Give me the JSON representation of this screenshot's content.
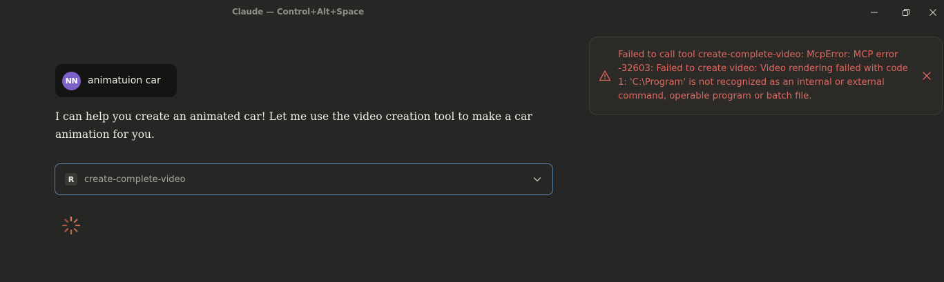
{
  "window": {
    "title": "Claude — Control+Alt+Space"
  },
  "user_message": {
    "avatar_initials": "NN",
    "text": "animatuion car"
  },
  "assistant_message": {
    "text": "I can help you create an animated car! Let me use the video creation tool to make a car animation for you."
  },
  "tool_call": {
    "icon_letter": "R",
    "name": "create-complete-video",
    "chevron_icon": "chevron-down-icon"
  },
  "error_toast": {
    "icon": "warning-icon",
    "message": "Failed to call tool create-complete-video: McpError: MCP error -32603: Failed to create video: Video rendering failed with code 1: 'C:\\Program' is not recognized as an internal or external command, operable program or batch file.",
    "close_icon": "close-icon"
  },
  "colors": {
    "background": "#262624",
    "error": "#e0675f",
    "accent_border": "#5b87ad",
    "avatar": "#7c61c9",
    "spinner": "#d97757"
  }
}
